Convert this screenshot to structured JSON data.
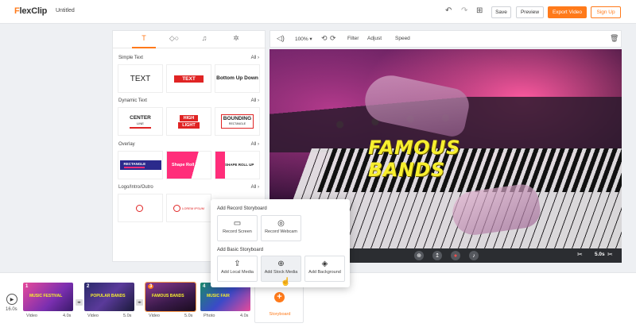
{
  "app": {
    "logo": "FlexClip",
    "project_title": "Untitled"
  },
  "toolbar": {
    "save": "Save",
    "preview": "Preview",
    "export": "Export Video",
    "signup": "Sign Up"
  },
  "panel": {
    "tabs": [
      "text",
      "elements",
      "music",
      "settings"
    ],
    "sections": {
      "simple_text": {
        "title": "Simple Text",
        "all": "All"
      },
      "dynamic_text": {
        "title": "Dynamic Text",
        "all": "All"
      },
      "overlay": {
        "title": "Overlay",
        "all": "All"
      },
      "logo_intro": {
        "title": "Logo/Intro/Outro",
        "all": "All"
      }
    },
    "simple": {
      "t1": "TEXT",
      "t2": "TEXT",
      "t3": "Bottom Up Down"
    },
    "dynamic": {
      "center": "CENTER",
      "center_sub": "LINE",
      "hl1": "HIGH",
      "hl2": "LIGHT",
      "bounding": "BOUNDING",
      "bounding_sub": "RECTANGLE"
    },
    "overlays": {
      "o1": "RECTANGLE",
      "o2": "Shape Roll Out",
      "o3": "SHAPE ROLL UP"
    },
    "logos": {
      "l2": "LOREM IPSUM"
    }
  },
  "editor": {
    "zoom": "100%",
    "filter": "Filter",
    "adjust": "Adjust",
    "speed": "Speed"
  },
  "video": {
    "overlay_text": "FAMOUS BANDS",
    "duration": "5.0s"
  },
  "popup": {
    "record_heading": "Add Record Storyboard",
    "record_screen": "Record Screen",
    "record_webcam": "Record Webcam",
    "basic_heading": "Add Basic Storyboard",
    "local_media": "Add Local Media",
    "stock_media": "Add Stock Media",
    "background": "Add Background"
  },
  "timeline": {
    "total": "16.0s",
    "clips": [
      {
        "num": "1",
        "type": "Video",
        "dur": "4.0s",
        "caption": "MUSIC FESTIVAL"
      },
      {
        "num": "2",
        "type": "Video",
        "dur": "5.0s",
        "caption": "POPULAR BANDS"
      },
      {
        "num": "3",
        "type": "Video",
        "dur": "5.0s",
        "caption": "FAMOUS BANDS"
      },
      {
        "num": "4",
        "type": "Photo",
        "dur": "4.0s",
        "caption": "MUSIC FAIR"
      }
    ],
    "storyboard": "Storyboard"
  },
  "colors": {
    "accent": "#ff7a1a",
    "red": "#e02424",
    "pink": "#ff2d7a",
    "yellow_text": "#f7ef2f"
  }
}
